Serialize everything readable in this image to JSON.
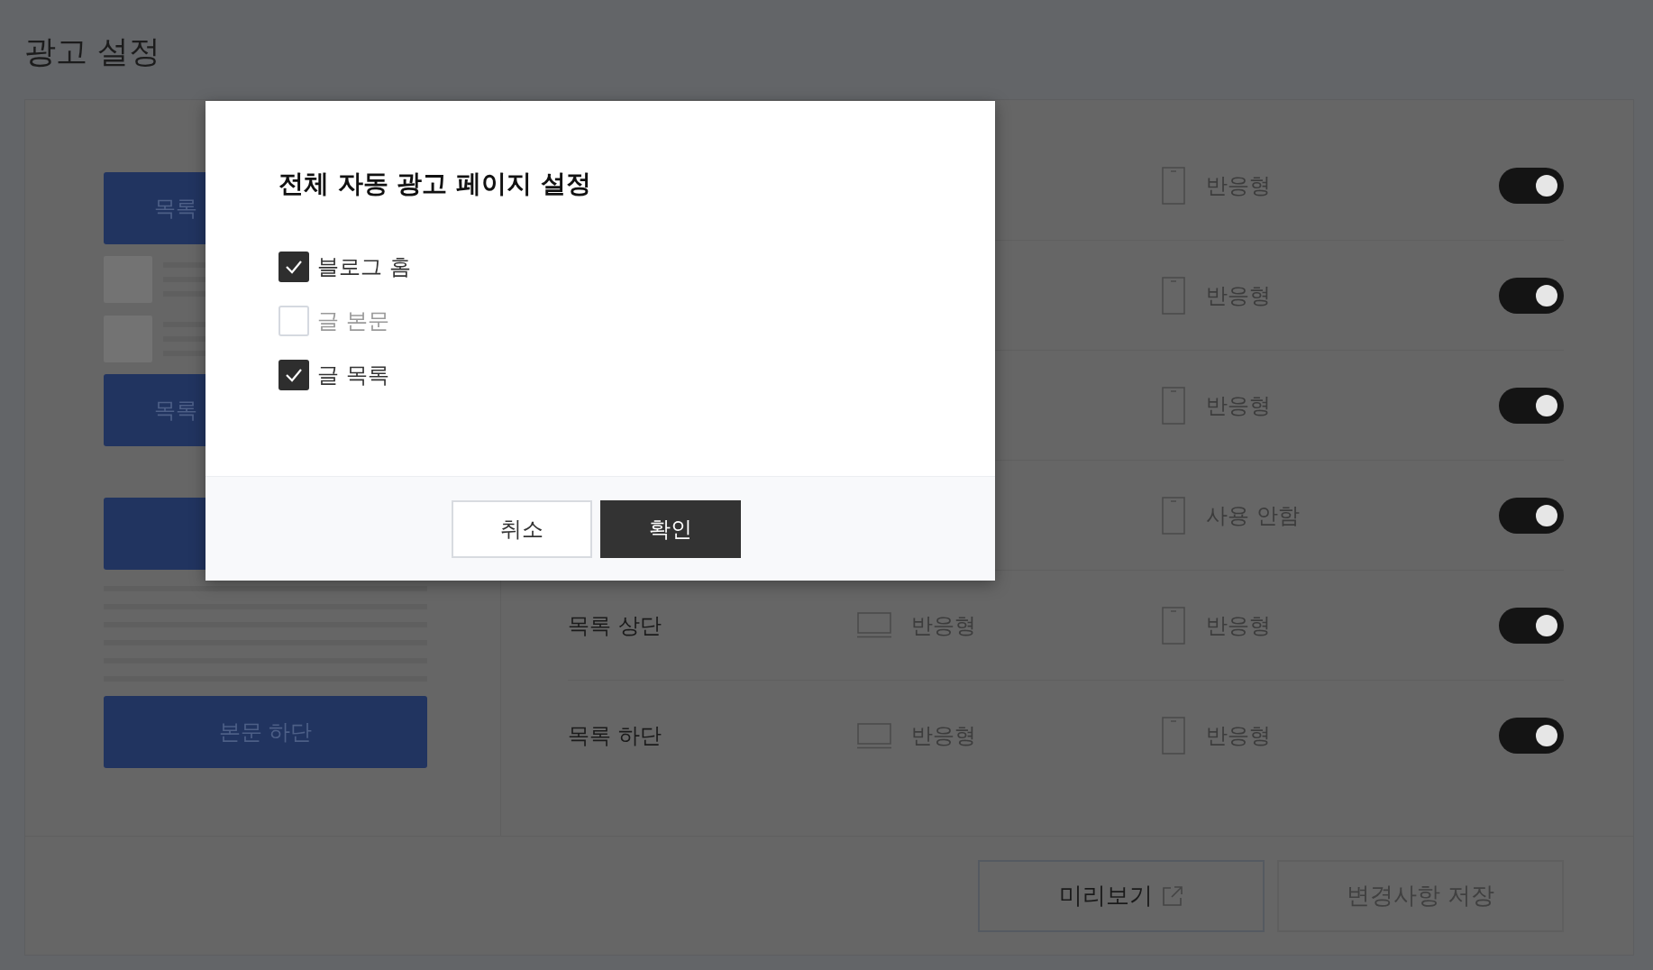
{
  "page_title": "광고 설정",
  "preview_blocks": [
    {
      "kind": "ad",
      "label": "목록"
    },
    {
      "kind": "thumbs"
    },
    {
      "kind": "ad",
      "label": "목록"
    },
    {
      "kind": "ad"
    },
    {
      "kind": "lines"
    },
    {
      "kind": "ad",
      "label": "본문 하단"
    }
  ],
  "rows": [
    {
      "mobile": "반응형",
      "on": true
    },
    {
      "mobile": "반응형",
      "on": true
    },
    {
      "mobile": "반응형",
      "on": true
    },
    {
      "mobile": "사용 안함",
      "on": true
    },
    {
      "label": "목록 상단",
      "pc": "반응형",
      "mobile": "반응형",
      "on": true
    },
    {
      "label": "목록 하단",
      "pc": "반응형",
      "mobile": "반응형",
      "on": true
    }
  ],
  "footer_buttons": [
    {
      "kind": "preview",
      "label": "미리보기"
    },
    {
      "kind": "save",
      "label": "변경사항 저장"
    }
  ],
  "dialog": {
    "title": "전체 자동 광고 페이지 설정",
    "options": [
      {
        "label": "블로그 홈",
        "checked": true
      },
      {
        "label": "글 본문",
        "checked": false
      },
      {
        "label": "글 목록",
        "checked": true
      }
    ],
    "buttons": [
      {
        "kind": "cancel",
        "label": "취소"
      },
      {
        "kind": "confirm",
        "label": "확인"
      }
    ]
  }
}
